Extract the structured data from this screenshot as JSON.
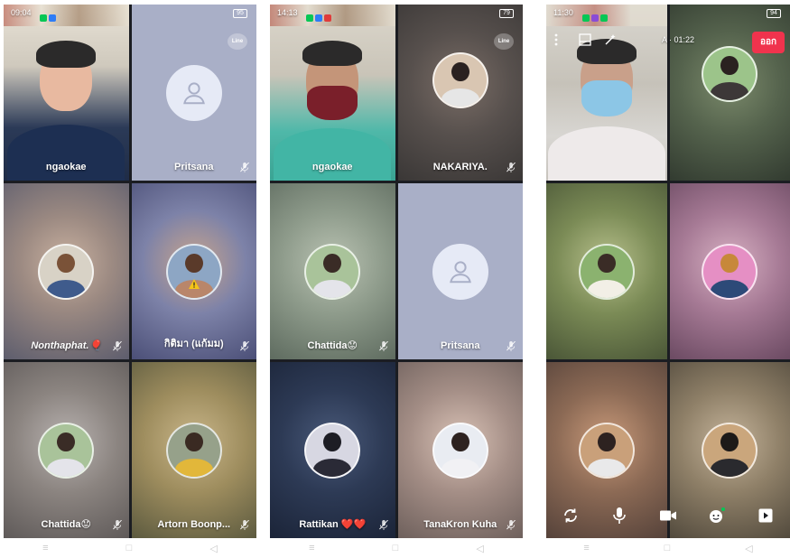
{
  "colors": {
    "line_green": "#06c755",
    "leave_red": "#f0334d",
    "default_tile": "#a9afc7",
    "avatar_placeholder": "#e6eaf6"
  },
  "phones": [
    {
      "status": {
        "time": "09:04",
        "battery": "95"
      },
      "line_badge": "Line",
      "tiles": [
        {
          "name": "ngaokae",
          "kind": "video"
        },
        {
          "name": "Pritsana",
          "kind": "default",
          "mic_muted": true
        },
        {
          "name": "Nonthaphat.🎈",
          "kind": "avatar",
          "mic_muted": true
        },
        {
          "name": "กิติมา (แก้มม)",
          "kind": "avatar",
          "mic_muted": true,
          "warning": true
        },
        {
          "name": "Chattida😟",
          "kind": "avatar",
          "mic_muted": true
        },
        {
          "name": "Artorn Boonp...",
          "kind": "avatar",
          "mic_muted": true
        }
      ],
      "nav": [
        "≡",
        "□",
        "◁"
      ]
    },
    {
      "status": {
        "time": "14:13",
        "battery": "79"
      },
      "line_badge": "Line",
      "tiles": [
        {
          "name": "ngaokae",
          "kind": "video"
        },
        {
          "name": "NAKARIYA.",
          "kind": "avatar",
          "mic_muted": true
        },
        {
          "name": "Chattida😟",
          "kind": "avatar",
          "mic_muted": true
        },
        {
          "name": "Pritsana",
          "kind": "default",
          "mic_muted": true
        },
        {
          "name": "Rattikan ❤️❤️",
          "kind": "avatar",
          "mic_muted": true
        },
        {
          "name": "TanaKron Kuha",
          "kind": "avatar",
          "mic_muted": true
        }
      ],
      "nav": [
        "≡",
        "□",
        "◁"
      ]
    },
    {
      "status": {
        "time": "11:30",
        "battery": "94"
      },
      "timer": "A · 01:22",
      "leave_label": "ออก",
      "tiles": [
        {
          "name": "",
          "kind": "video"
        },
        {
          "name": "",
          "kind": "avatar"
        },
        {
          "name": "",
          "kind": "avatar"
        },
        {
          "name": "",
          "kind": "avatar"
        },
        {
          "name": "",
          "kind": "avatar"
        },
        {
          "name": "",
          "kind": "avatar"
        }
      ],
      "controls": [
        "flip-camera-icon",
        "microphone-icon",
        "video-camera-icon",
        "effects-icon",
        "share-screen-icon"
      ],
      "nav": [
        "≡",
        "□",
        "◁"
      ]
    }
  ]
}
